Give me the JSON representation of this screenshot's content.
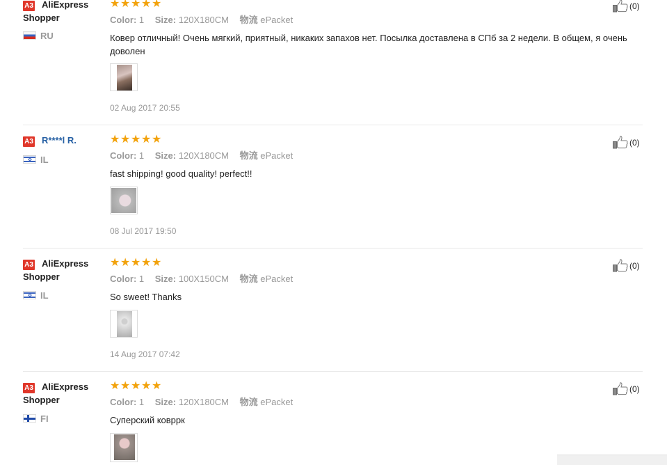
{
  "reviews": [
    {
      "badge": "A3",
      "buyer": "AliExpress Shopper",
      "country": "RU",
      "flag": "ru",
      "stars": 5,
      "color_label": "Color:",
      "color_value": "1",
      "size_label": "Size:",
      "size_value": "120X180CM",
      "shipping_label": "物流",
      "shipping_value": "ePacket",
      "text": "Ковер отличный! Очень мягкий, приятный, никаких запахов нет. Посылка доставлена в СПб за 2 недели. В общем, я очень доволен",
      "date": "02 Aug 2017 20:55",
      "likes": "(0)"
    },
    {
      "badge": "A3",
      "buyer": "R****l R.",
      "country": "IL",
      "flag": "il",
      "stars": 5,
      "color_label": "Color:",
      "color_value": "1",
      "size_label": "Size:",
      "size_value": "120X180CM",
      "shipping_label": "物流",
      "shipping_value": "ePacket",
      "text": "fast shipping! good quality! perfect!!",
      "date": "08 Jul 2017 19:50",
      "likes": "(0)"
    },
    {
      "badge": "A3",
      "buyer": "AliExpress Shopper",
      "country": "IL",
      "flag": "il",
      "stars": 5,
      "color_label": "Color:",
      "color_value": "1",
      "size_label": "Size:",
      "size_value": "100X150CM",
      "shipping_label": "物流",
      "shipping_value": "ePacket",
      "text": "So sweet! Thanks",
      "date": "14 Aug 2017 07:42",
      "likes": "(0)"
    },
    {
      "badge": "A3",
      "buyer": "AliExpress Shopper",
      "country": "FI",
      "flag": "fi",
      "stars": 5,
      "color_label": "Color:",
      "color_value": "1",
      "size_label": "Size:",
      "size_value": "120X180CM",
      "shipping_label": "物流",
      "shipping_value": "ePacket",
      "text": "Суперский ковррк",
      "date": "",
      "likes": "(0)"
    }
  ],
  "icons": {
    "star": "star-icon",
    "like": "thumbs-up-icon"
  },
  "colors": {
    "star": "#f2a20c",
    "badge": "#e0372a",
    "masked_name": "#2660a4"
  }
}
